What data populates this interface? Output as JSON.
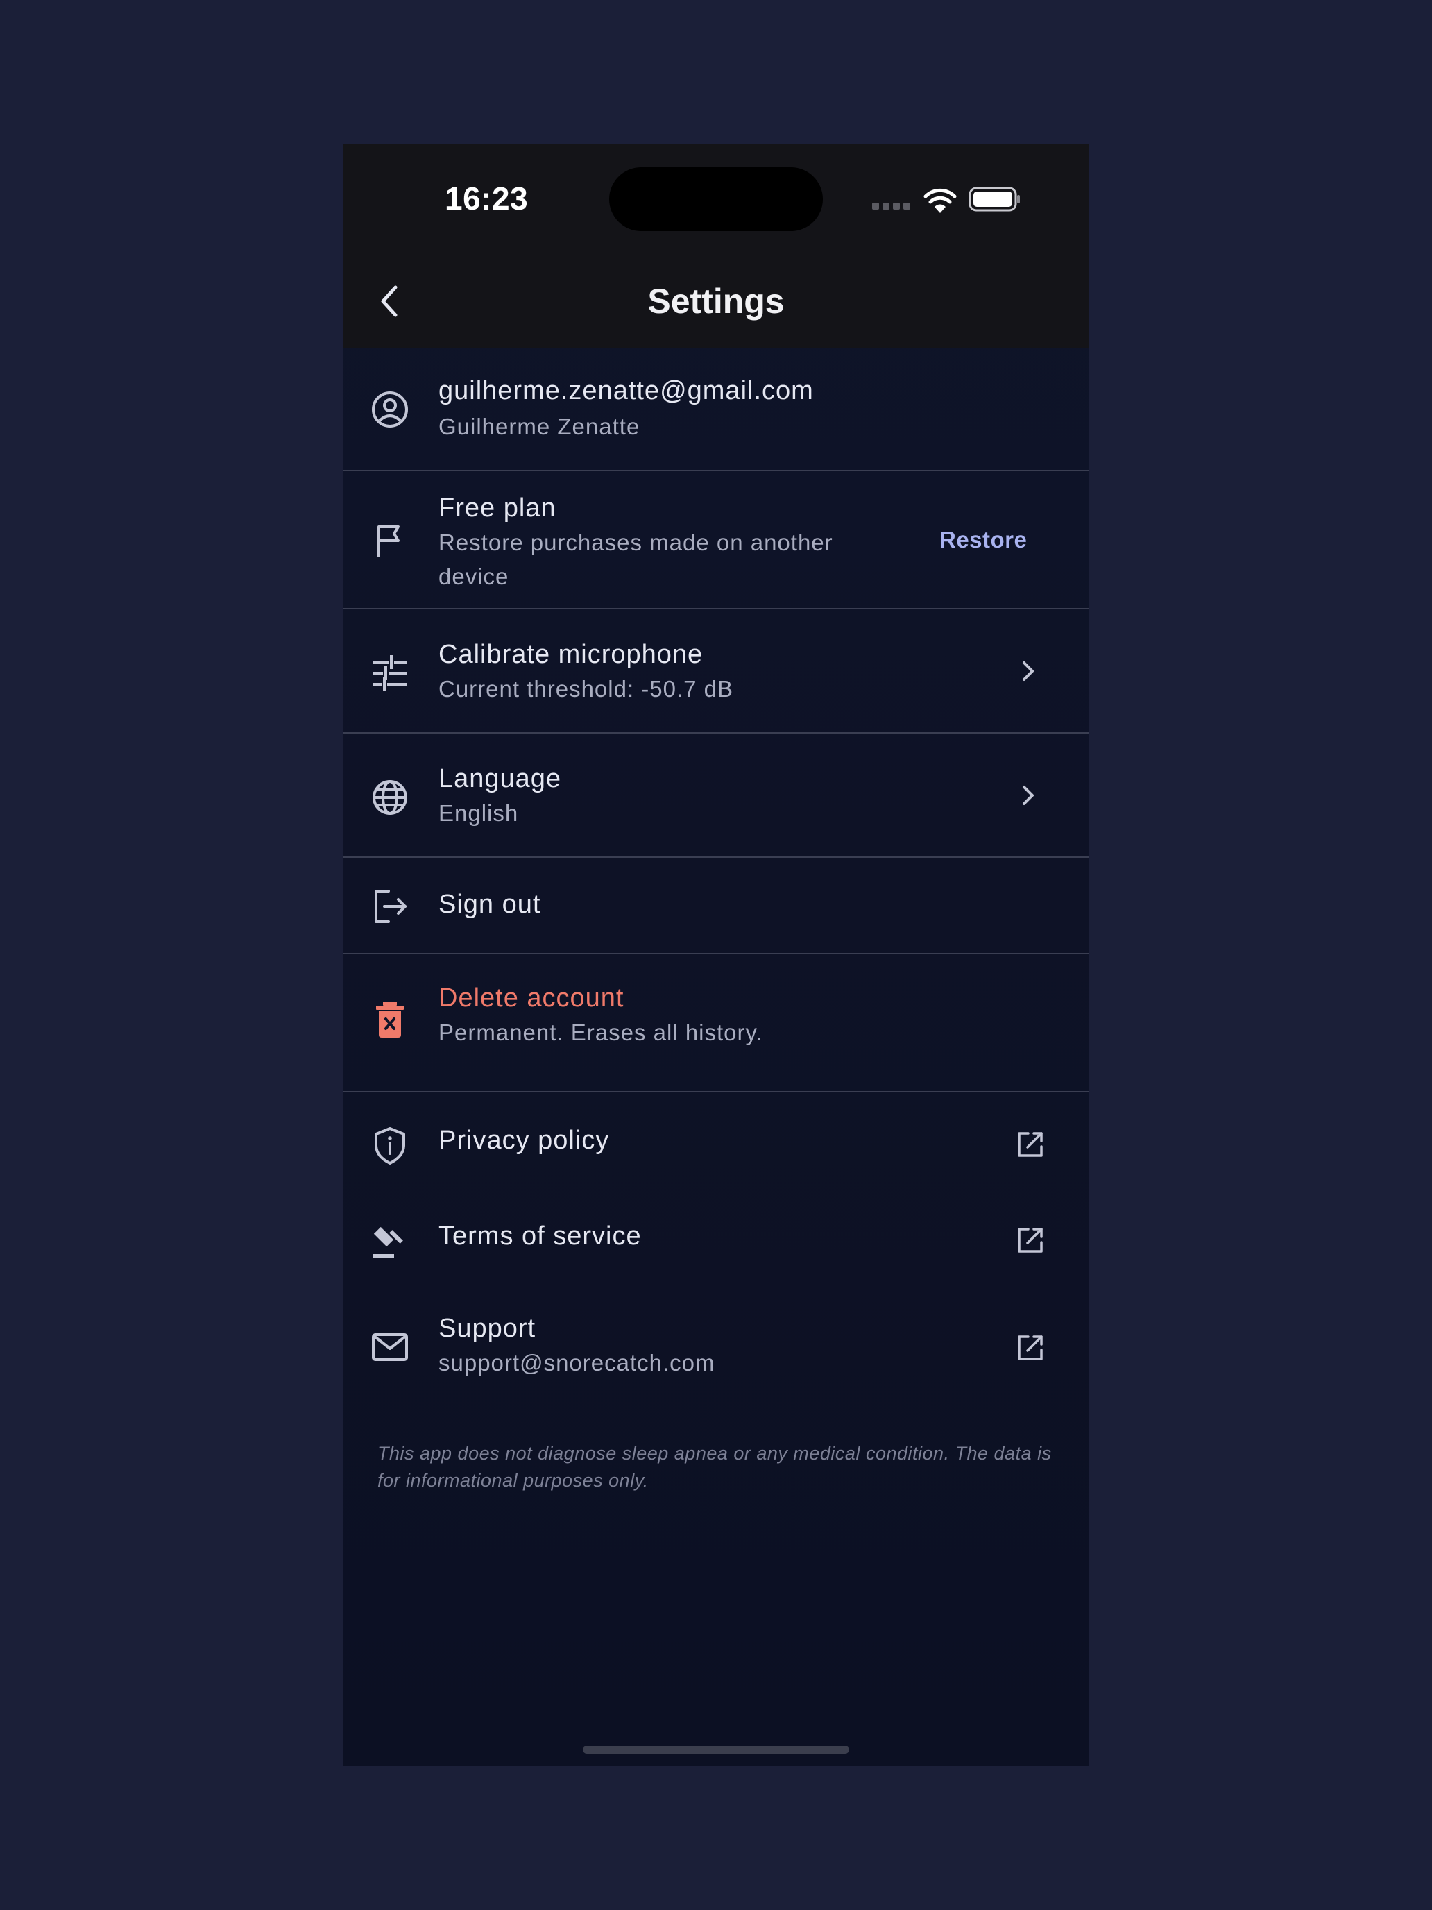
{
  "status_bar": {
    "time": "16:23"
  },
  "nav": {
    "title": "Settings",
    "back_icon": "chevron-left-icon"
  },
  "account": {
    "email": "guilherme.zenatte@gmail.com",
    "name": "Guilherme Zenatte",
    "icon": "user-circle-icon"
  },
  "plan": {
    "title": "Free plan",
    "subtitle": "Restore purchases made on another device",
    "action_label": "Restore",
    "icon": "flag-icon"
  },
  "calibrate": {
    "title": "Calibrate microphone",
    "subtitle": "Current threshold: -50.7 dB",
    "icon": "sliders-icon"
  },
  "language": {
    "title": "Language",
    "value": "English",
    "icon": "globe-icon"
  },
  "sign_out": {
    "title": "Sign out",
    "icon": "logout-icon"
  },
  "delete_account": {
    "title": "Delete account",
    "subtitle": "Permanent. Erases all history.",
    "icon": "trash-icon",
    "color": "#f07a6a"
  },
  "links": [
    {
      "title": "Privacy policy",
      "icon": "shield-info-icon"
    },
    {
      "title": "Terms of service",
      "icon": "gavel-icon"
    },
    {
      "title": "Support",
      "subtitle": "support@snorecatch.com",
      "icon": "mail-icon"
    }
  ],
  "disclaimer": "This app does not diagnose sleep apnea or any medical condition. The data is for informational purposes only.",
  "colors": {
    "background": "#1b1f38",
    "surface": "#0f1429",
    "header": "#141418",
    "accent": "#a9b3f0",
    "danger": "#f07a6a"
  }
}
